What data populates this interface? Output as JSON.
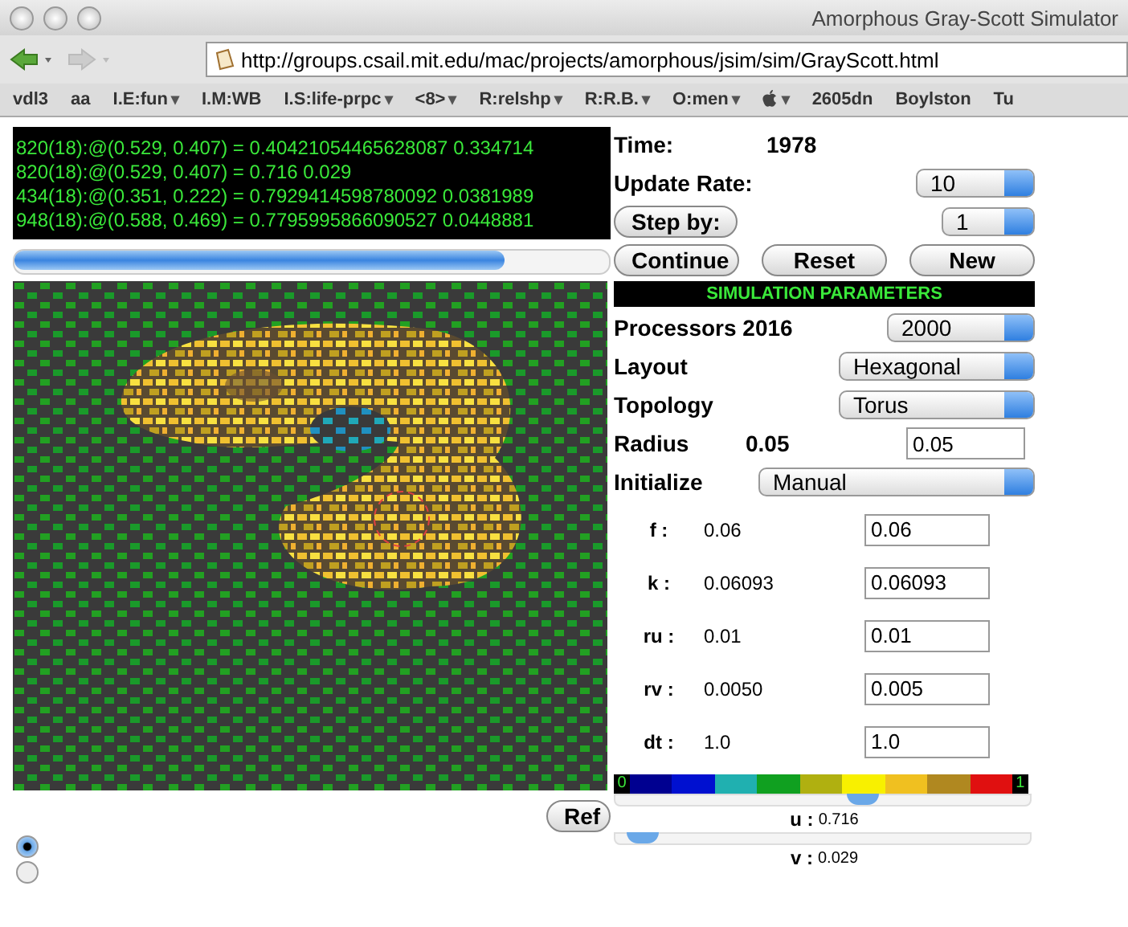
{
  "window": {
    "title": "Amorphous Gray-Scott Simulator"
  },
  "address_bar": {
    "value": "http://groups.csail.mit.edu/mac/projects/amorphous/jsim/sim/GrayScott.html"
  },
  "bookmarks": [
    {
      "kind": "text",
      "label": "vdl3"
    },
    {
      "kind": "text",
      "label": "aa"
    },
    {
      "kind": "text",
      "label": "I.E:fun",
      "caret": "▾"
    },
    {
      "kind": "text",
      "label": "I.M:WB"
    },
    {
      "kind": "text",
      "label": "I.S:life-prpc",
      "caret": "▾"
    },
    {
      "kind": "text",
      "label": "<8>",
      "caret": "▾"
    },
    {
      "kind": "text",
      "label": "R:relshp",
      "caret": "▾"
    },
    {
      "kind": "text",
      "label": "R:R.B.",
      "caret": "▾"
    },
    {
      "kind": "text",
      "label": "O:men",
      "caret": "▾"
    },
    {
      "kind": "apple",
      "caret": "▾"
    },
    {
      "kind": "text",
      "label": "2605dn"
    },
    {
      "kind": "text",
      "label": "Boylston"
    },
    {
      "kind": "text",
      "label": "Tu"
    }
  ],
  "console": {
    "lines": [
      "820(18):@(0.529, 0.407) = 0.40421054465628087  0.334714",
      "820(18):@(0.529, 0.407) = 0.716  0.029",
      "434(18):@(0.351, 0.222) = 0.7929414598780092  0.0381989",
      "948(18):@(0.588, 0.469) = 0.7795995866090527  0.0448881"
    ]
  },
  "controls": {
    "time_label": "Time:",
    "time_value": "1978",
    "update_rate_label": "Update Rate:",
    "update_rate": "10",
    "step_button": "Step by:",
    "step": "1",
    "buttons": [
      "Continue",
      "Reset",
      "New"
    ]
  },
  "parameters": {
    "header": "SIMULATION PARAMETERS",
    "processors_label": "Processors 2016",
    "processors": "2000",
    "layout_label": "Layout",
    "layout": "Hexagonal",
    "topology_label": "Topology",
    "topology": "Torus",
    "radius_label": "Radius",
    "radius_value": "0.05",
    "radius_input": "0.05",
    "initialize_label": "Initialize",
    "initialize": "Manual",
    "rows": [
      {
        "label": "f :",
        "value": "0.06",
        "input": "0.06"
      },
      {
        "label": "k :",
        "value": "0.06093",
        "input": "0.06093"
      },
      {
        "label": "ru :",
        "value": "0.01",
        "input": "0.01"
      },
      {
        "label": "rv :",
        "value": "0.0050",
        "input": "0.005"
      },
      {
        "label": "dt :",
        "value": "1.0",
        "input": "1.0"
      }
    ]
  },
  "colorbar": {
    "min_label": "0",
    "max_label": "1",
    "segments": [
      {
        "color": "#000090"
      },
      {
        "color": "#0010d0"
      },
      {
        "color": "#20b0b0"
      },
      {
        "color": "#10a020"
      },
      {
        "color": "#b0b010"
      },
      {
        "color": "#f8f000"
      },
      {
        "color": "#f0c020"
      },
      {
        "color": "#b08820"
      },
      {
        "color": "#e01010"
      }
    ]
  },
  "sliders": [
    {
      "label": "u :",
      "reading": "0.716",
      "level": 0.6
    },
    {
      "label": "v :",
      "reading": "0.029",
      "level": 0.03
    }
  ],
  "refresh_button": {
    "label": "Ref"
  },
  "radios": [
    {
      "selected": true
    },
    {
      "selected": false
    }
  ]
}
